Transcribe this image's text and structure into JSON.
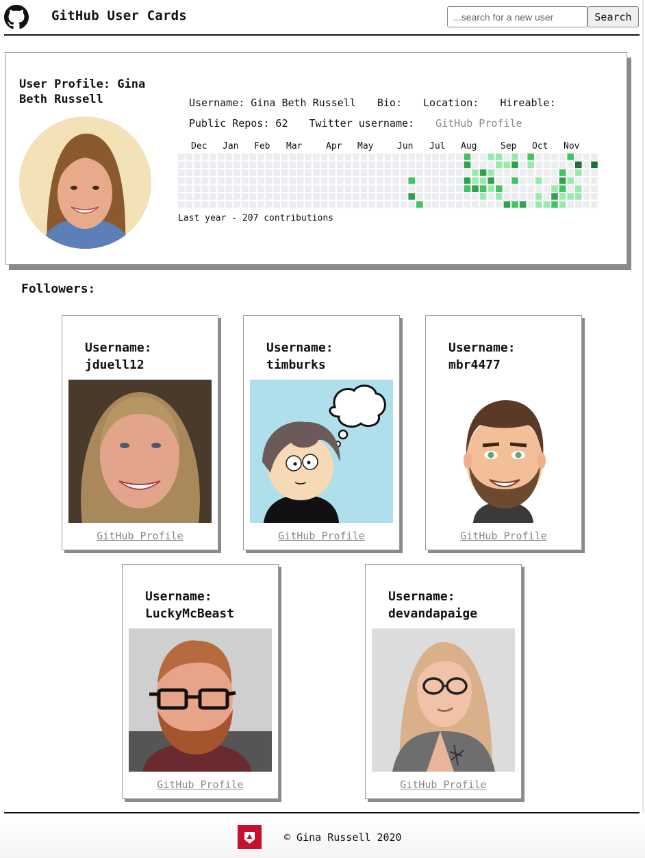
{
  "header": {
    "title": "GitHub User Cards",
    "search_placeholder": "...search for a new user",
    "search_button": "Search"
  },
  "profile": {
    "title": "User Profile: Gina Beth Russell",
    "username": "Username: Gina Beth Russell",
    "bio": "Bio:",
    "location": "Location:",
    "hireable": "Hireable:",
    "repos": "Public Repos: 62",
    "twitter": "Twitter username:",
    "profile_link": "GitHub Profile"
  },
  "contributions": {
    "months": [
      "Dec",
      "Jan",
      "Feb",
      "Mar",
      "Apr",
      "May",
      "Jun",
      "Jul",
      "Aug",
      "Sep",
      "Oct",
      "Nov"
    ],
    "caption": "Last year - 207 contributions",
    "colors": [
      "#ebedf0",
      "#9be9a8",
      "#40c463",
      "#30a14e",
      "#216e39"
    ]
  },
  "followers_heading": "Followers:",
  "followers": [
    {
      "label": "Username:",
      "username": "jduell12",
      "link": "GitHub Profile"
    },
    {
      "label": "Username:",
      "username": "timburks",
      "link": "GitHub Profile"
    },
    {
      "label": "Username:",
      "username": "mbr4477",
      "link": "GitHub Profile"
    },
    {
      "label": "Username:",
      "username": "LuckyMcBeast",
      "link": "GitHub Profile"
    },
    {
      "label": "Username:",
      "username": "devandapaige",
      "link": "GitHub Profile"
    }
  ],
  "footer": {
    "copyright": "© Gina Russell 2020"
  }
}
